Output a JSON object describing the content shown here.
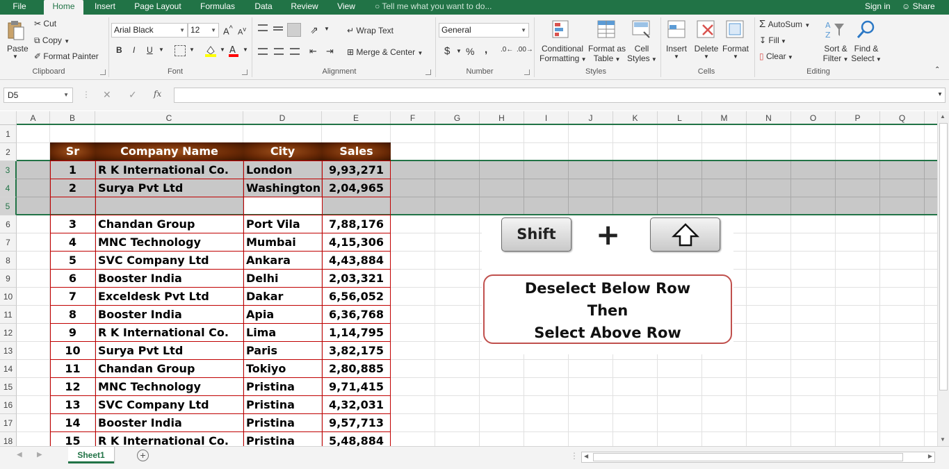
{
  "menubar": {
    "tabs": [
      "File",
      "Home",
      "Insert",
      "Page Layout",
      "Formulas",
      "Data",
      "Review",
      "View"
    ],
    "tell_me": "Tell me what you want to do...",
    "sign_in": "Sign in",
    "share": "Share"
  },
  "ribbon": {
    "clipboard": {
      "paste": "Paste",
      "cut": "Cut",
      "copy": "Copy",
      "format_painter": "Format Painter",
      "label": "Clipboard"
    },
    "font": {
      "name": "Arial Black",
      "size": "12",
      "bold": "B",
      "italic": "I",
      "underline": "U",
      "label": "Font"
    },
    "alignment": {
      "wrap_text": "Wrap Text",
      "merge_center": "Merge & Center",
      "label": "Alignment"
    },
    "number": {
      "format": "General",
      "currency": "$",
      "percent": "%",
      "comma": ",",
      "label": "Number"
    },
    "styles": {
      "conditional_line1": "Conditional",
      "conditional_line2": "Formatting",
      "format_as_line1": "Format as",
      "format_as_line2": "Table",
      "cell_styles_line1": "Cell",
      "cell_styles_line2": "Styles",
      "label": "Styles"
    },
    "cells": {
      "insert": "Insert",
      "delete": "Delete",
      "format": "Format",
      "label": "Cells"
    },
    "editing": {
      "autosum": "AutoSum",
      "fill": "Fill",
      "clear": "Clear",
      "sort_line1": "Sort &",
      "sort_line2": "Filter",
      "find_line1": "Find &",
      "find_line2": "Select",
      "label": "Editing"
    }
  },
  "formula_bar": {
    "name_box": "D5",
    "fx": "fx",
    "content": ""
  },
  "columns": [
    "A",
    "B",
    "C",
    "D",
    "E",
    "F",
    "G",
    "H",
    "I",
    "J",
    "K",
    "L",
    "M",
    "N",
    "O",
    "P",
    "Q"
  ],
  "rows": [
    "1",
    "2",
    "3",
    "4",
    "5",
    "6",
    "7",
    "8",
    "9",
    "10",
    "11",
    "12",
    "13",
    "14",
    "15",
    "16",
    "17",
    "18"
  ],
  "table": {
    "headers": {
      "sr": "Sr",
      "company": "Company Name",
      "city": "City",
      "sales": "Sales"
    },
    "data": [
      [
        "1",
        "R K International Co.",
        "London",
        "9,93,271"
      ],
      [
        "2",
        "Surya Pvt Ltd",
        "Washington",
        "2,04,965"
      ],
      [
        "",
        "",
        "",
        ""
      ],
      [
        "3",
        "Chandan Group",
        "Port Vila",
        "7,88,176"
      ],
      [
        "4",
        "MNC Technology",
        "Mumbai",
        "4,15,306"
      ],
      [
        "5",
        "SVC Company Ltd",
        "Ankara",
        "4,43,884"
      ],
      [
        "6",
        "Booster India",
        "Delhi",
        "2,03,321"
      ],
      [
        "7",
        "Exceldesk Pvt Ltd",
        "Dakar",
        "6,56,052"
      ],
      [
        "8",
        "Booster India",
        "Apia",
        "6,36,768"
      ],
      [
        "9",
        "R K International Co.",
        "Lima",
        "1,14,795"
      ],
      [
        "10",
        "Surya Pvt Ltd",
        "Paris",
        "3,82,175"
      ],
      [
        "11",
        "Chandan Group",
        "Tokiyo",
        "2,80,885"
      ],
      [
        "12",
        "MNC Technology",
        "Pristina",
        "9,71,415"
      ],
      [
        "13",
        "SVC Company Ltd",
        "Pristina",
        "4,32,031"
      ],
      [
        "14",
        "Booster India",
        "Pristina",
        "9,57,713"
      ],
      [
        "15",
        "R K International Co.",
        "Pristina",
        "5,48,884"
      ]
    ]
  },
  "overlay": {
    "key1": "Shift",
    "plus": "+",
    "callout_line1": "Deselect Below Row",
    "callout_line2": "Then",
    "callout_line3": "Select Above Row"
  },
  "sheets": {
    "active": "Sheet1"
  },
  "colors": {
    "accent": "#217346",
    "table_border": "#c00000",
    "selection": "#c8c8c8",
    "callout_border": "#c0504d"
  }
}
